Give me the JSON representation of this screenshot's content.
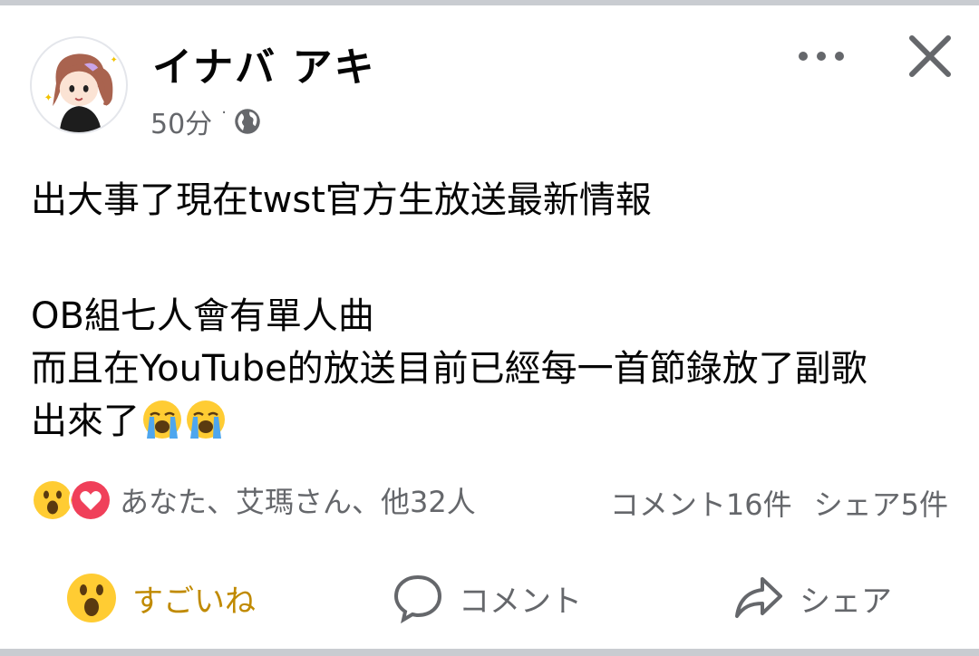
{
  "post": {
    "author": "イナバ アキ",
    "time": "50分",
    "privacy_icon": "globe-icon",
    "lines": [
      "出大事了現在twst官方生放送最新情報",
      "OB組七人會有單人曲",
      "而且在YouTube的放送目前已經每一首節錄放了副歌",
      "出來了"
    ],
    "line_emojis": [
      "loudly-crying-face",
      "loudly-crying-face"
    ]
  },
  "reactions": {
    "icons": [
      "wow-reaction-icon",
      "love-reaction-icon"
    ],
    "summary": "あなた、艾瑪さん、他32人",
    "comments_count": "コメント16件",
    "shares_count": "シェア5件"
  },
  "actions": {
    "like_label": "すごいね",
    "comment_label": "コメント",
    "share_label": "シェア"
  },
  "colors": {
    "active_reaction": "#c08a00",
    "secondary_text": "#65676b",
    "divider": "#c9ccd1"
  }
}
